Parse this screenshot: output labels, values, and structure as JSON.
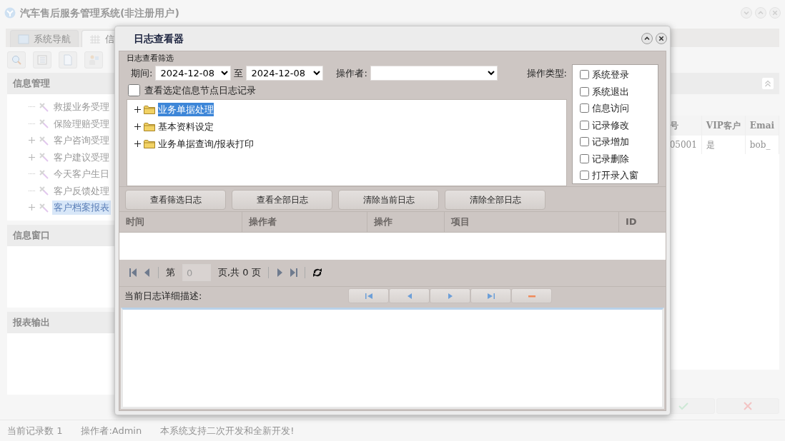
{
  "window": {
    "title": "汽车售后服务管理系统(非注册用户)"
  },
  "tabs": [
    {
      "label": "系统导航",
      "selected": false
    },
    {
      "label": "信",
      "selected": true
    }
  ],
  "sidebar": {
    "sections": [
      {
        "title": "信息管理",
        "items": [
          {
            "label": "救援业务受理",
            "expandable": false,
            "selected": false
          },
          {
            "label": "保险理赔受理",
            "expandable": false,
            "selected": false
          },
          {
            "label": "客户咨询受理",
            "expandable": true,
            "selected": false
          },
          {
            "label": "客户建议受理",
            "expandable": true,
            "selected": false
          },
          {
            "label": "今天客户生日",
            "expandable": false,
            "selected": false
          },
          {
            "label": "客户反馈处理",
            "expandable": false,
            "selected": false
          },
          {
            "label": "客户档案报表",
            "expandable": true,
            "selected": true
          }
        ]
      },
      {
        "title": "信息窗口"
      },
      {
        "title": "报表输出"
      }
    ]
  },
  "table": {
    "columns": [
      "号",
      "VIP客户",
      "Emai"
    ],
    "rows": [
      [
        "05001",
        "是",
        "bob_"
      ]
    ]
  },
  "status_bar": [
    "当前记录数 1",
    "操作者:Admin",
    "本系统支持二次开发和全新开发!"
  ],
  "dialog": {
    "title": "日志查看器",
    "filter_title": "日志查看筛选",
    "period_label": "期间:",
    "date_from": "2024-12-08",
    "to_label": "至",
    "date_to": "2024-12-08",
    "operator_label": "操作者:",
    "operation_type_label": "操作类型:",
    "operation_types": [
      {
        "label": "系统登录",
        "checked": false
      },
      {
        "label": "系统退出",
        "checked": false
      },
      {
        "label": "信息访问",
        "checked": false
      },
      {
        "label": "记录修改",
        "checked": false
      },
      {
        "label": "记录增加",
        "checked": false
      },
      {
        "label": "记录删除",
        "checked": false
      },
      {
        "label": "打开录入窗",
        "checked": false
      }
    ],
    "node_filter": {
      "label": "查看选定信息节点日志记录",
      "checked": false
    },
    "tree": [
      {
        "label": "业务单据处理",
        "expanded": false,
        "selected": true
      },
      {
        "label": "基本资料设定",
        "expanded": false,
        "selected": false
      },
      {
        "label": "业务单据查询/报表打印",
        "expanded": false,
        "selected": false
      }
    ],
    "buttons": [
      "查看筛选日志",
      "查看全部日志",
      "清除当前日志",
      "清除全部日志"
    ],
    "grid_columns": [
      "时间",
      "操作者",
      "操作",
      "项目",
      "ID"
    ],
    "pager": {
      "page_label": "第",
      "page_value": "0",
      "page_total": "页,共 0 页"
    },
    "detail_label": "当前日志详细描述:"
  }
}
